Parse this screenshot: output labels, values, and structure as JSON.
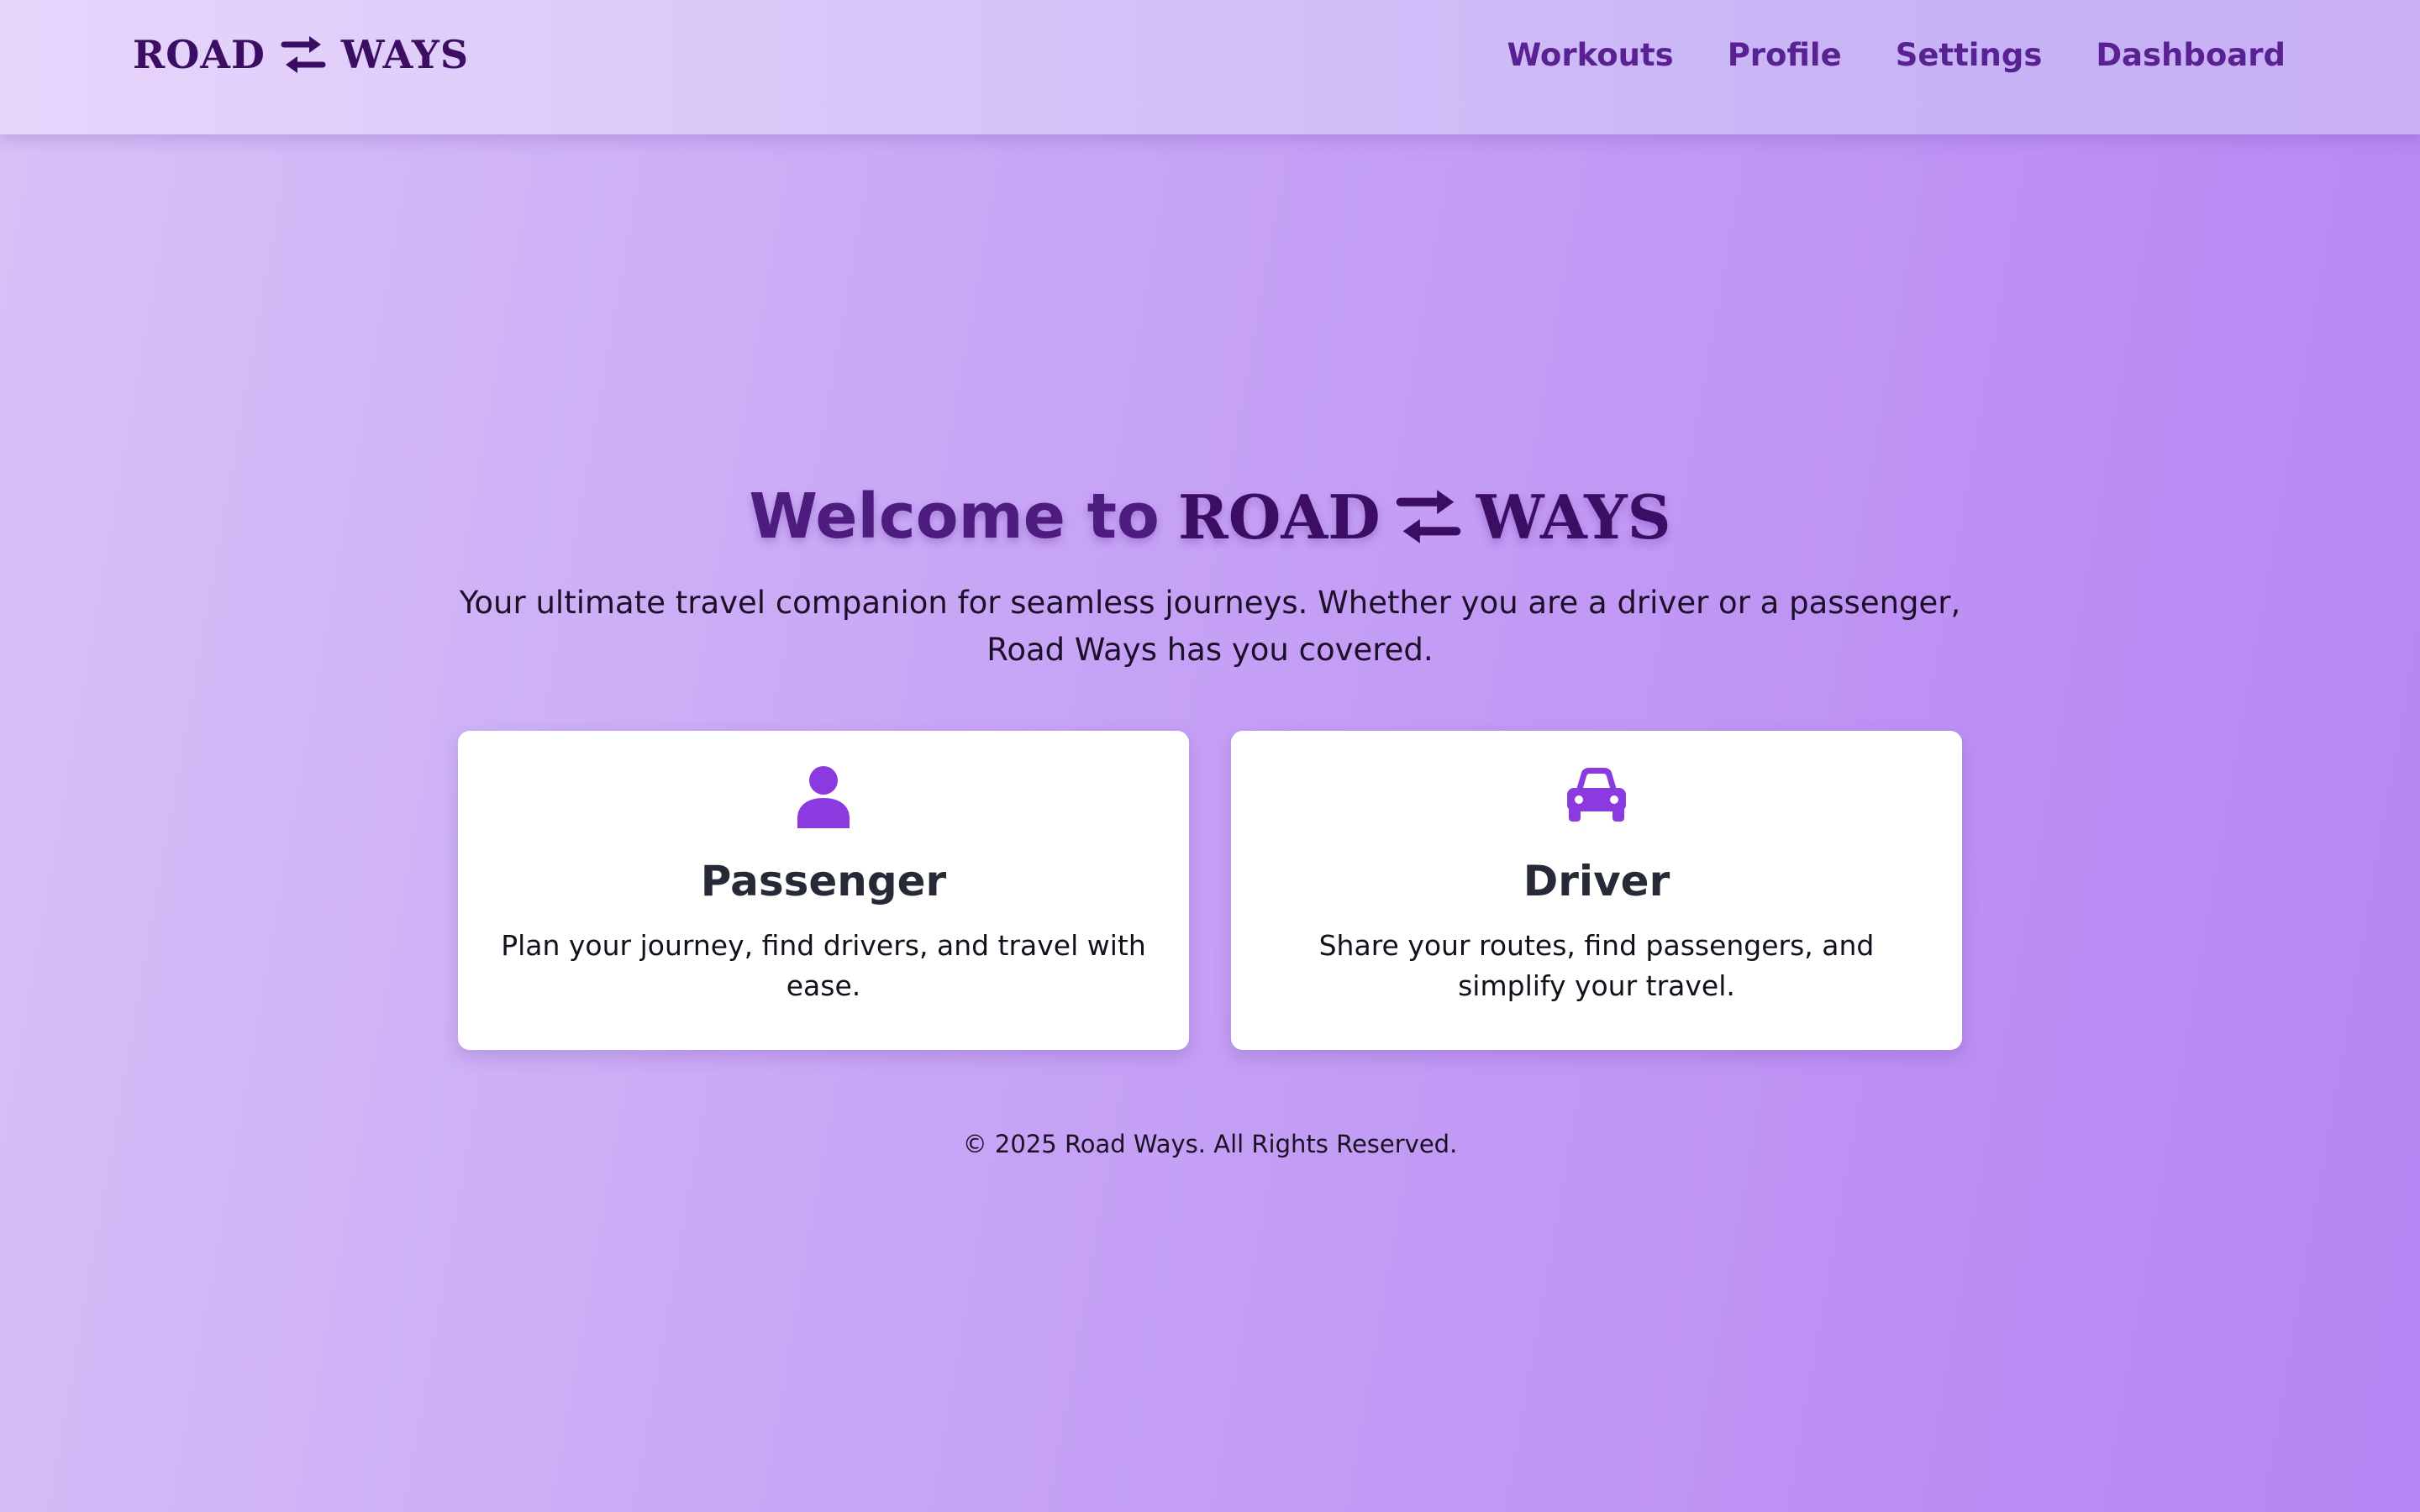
{
  "header": {
    "brand": {
      "left_word": "ROAD",
      "right_word": "WAYS",
      "icon": "swap-arrows-icon"
    },
    "nav": [
      {
        "label": "Workouts"
      },
      {
        "label": "Profile"
      },
      {
        "label": "Settings"
      },
      {
        "label": "Dashboard"
      }
    ]
  },
  "hero": {
    "welcome": "Welcome to",
    "logo_left": "ROAD",
    "logo_right": "WAYS",
    "tagline": "Your ultimate travel companion for seamless journeys. Whether you are a driver or a passenger, Road Ways has you covered."
  },
  "cards": [
    {
      "icon": "user-icon",
      "title": "Passenger",
      "description": "Plan your journey, find drivers, and travel with ease."
    },
    {
      "icon": "car-icon",
      "title": "Driver",
      "description": "Share your routes, find passengers, and simplify your travel."
    }
  ],
  "footer": {
    "copyright": "© 2025 Road Ways. All Rights Reserved."
  },
  "colors": {
    "brand_dark": "#3c0e63",
    "nav_text": "#5a2192",
    "accent_icon": "#8b3ae0",
    "card_bg": "#ffffff"
  }
}
